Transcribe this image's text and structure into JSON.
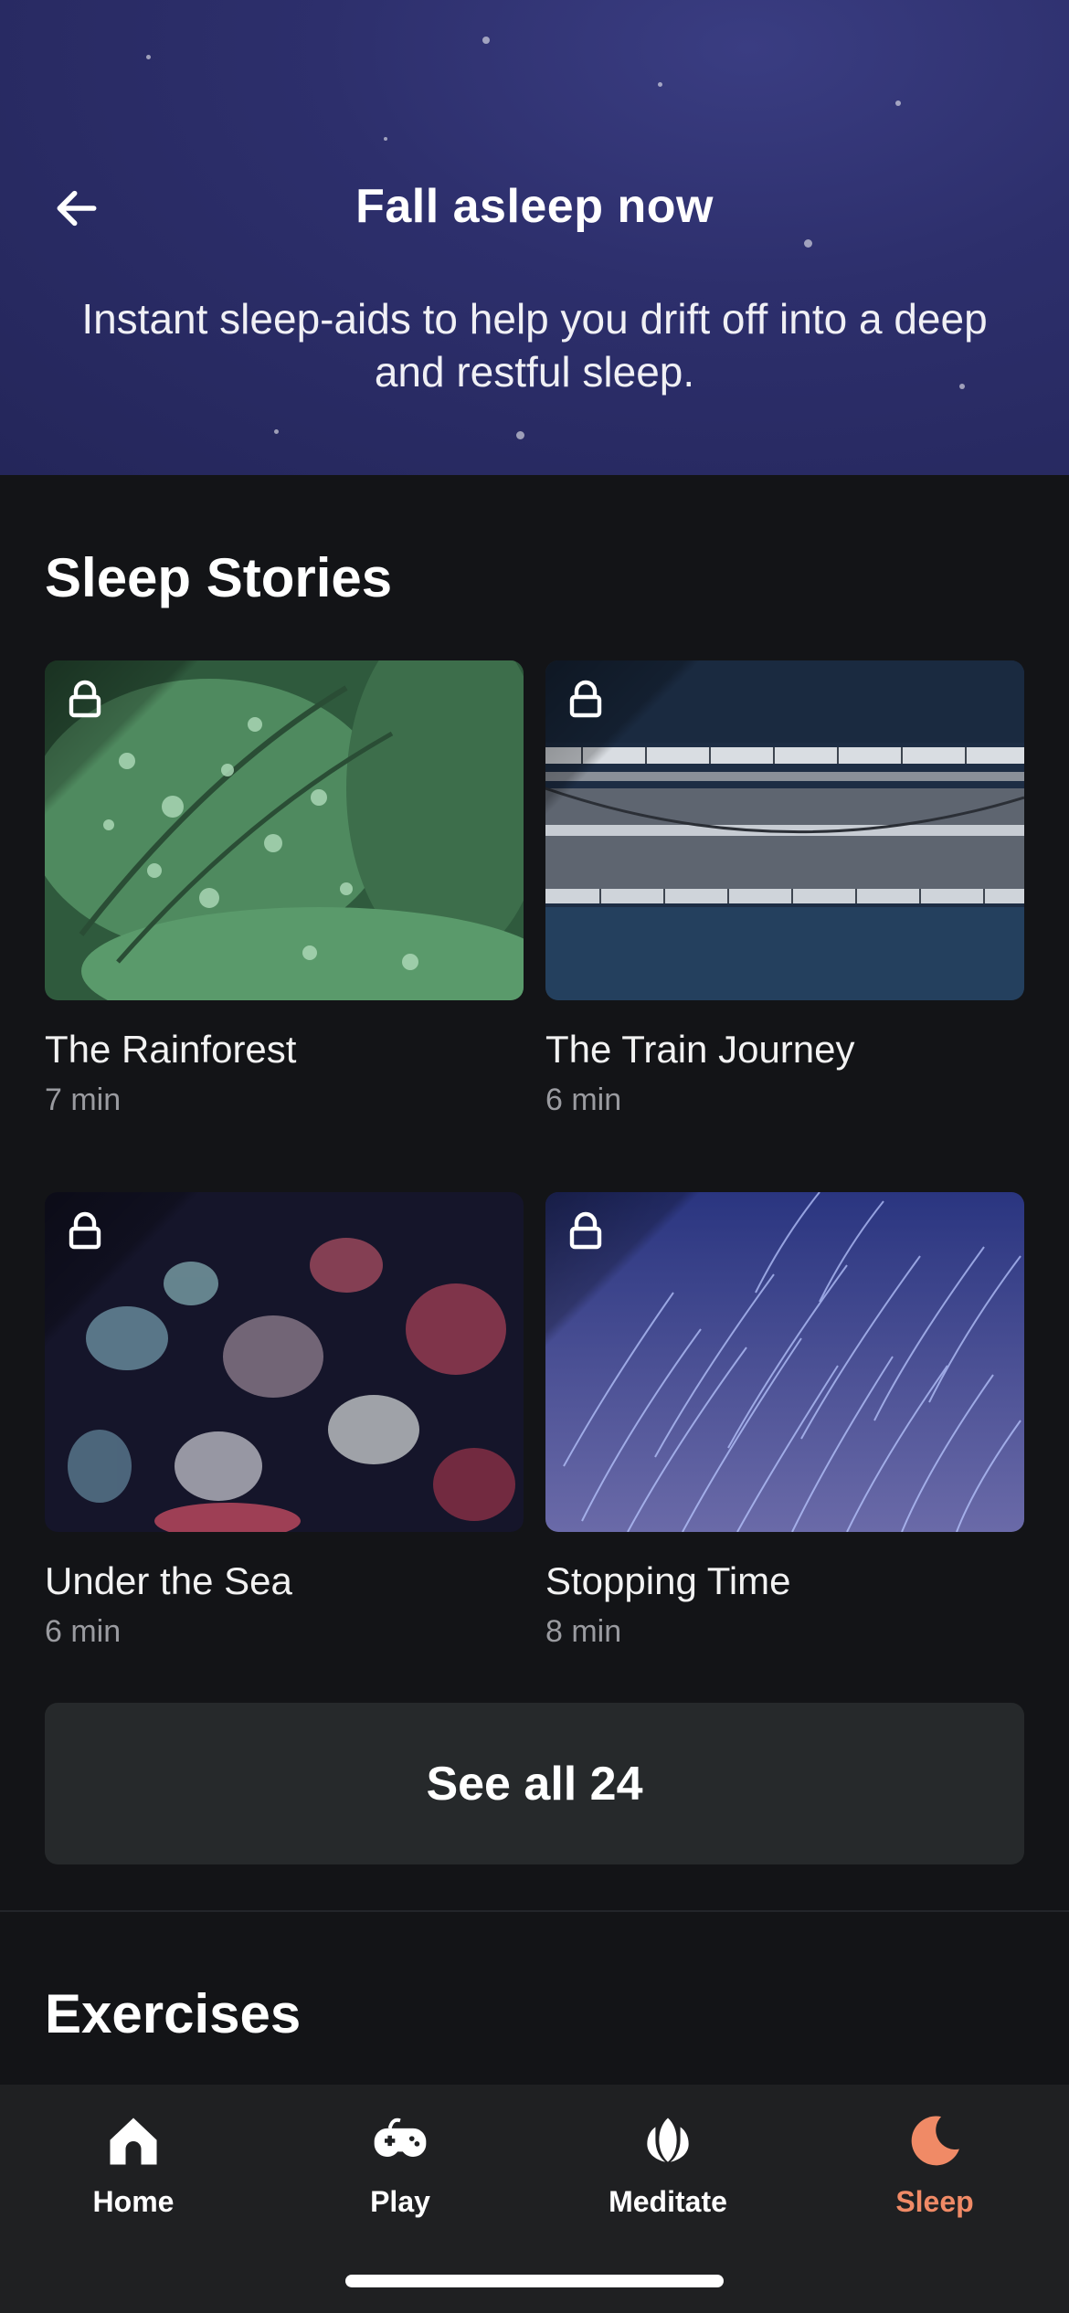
{
  "header": {
    "title": "Fall asleep now",
    "subtitle": "Instant sleep-aids to help you drift off into a deep and restful sleep.",
    "back_icon": "arrow-left-icon"
  },
  "sleep_stories": {
    "title": "Sleep Stories",
    "items": [
      {
        "title": "The Rainforest",
        "duration": "7 min",
        "locked": true
      },
      {
        "title": "The Train Journey",
        "duration": "6 min",
        "locked": true
      },
      {
        "title": "Under the Sea",
        "duration": "6 min",
        "locked": true
      },
      {
        "title": "Stopping Time",
        "duration": "8 min",
        "locked": true
      }
    ],
    "see_all_label": "See all 24"
  },
  "exercises": {
    "title": "Exercises"
  },
  "tabbar": {
    "items": [
      {
        "label": "Home",
        "icon": "house-icon"
      },
      {
        "label": "Play",
        "icon": "gamepad-icon"
      },
      {
        "label": "Meditate",
        "icon": "lotus-icon"
      },
      {
        "label": "Sleep",
        "icon": "moon-icon",
        "active": true
      }
    ],
    "active_color": "#f08a66"
  }
}
